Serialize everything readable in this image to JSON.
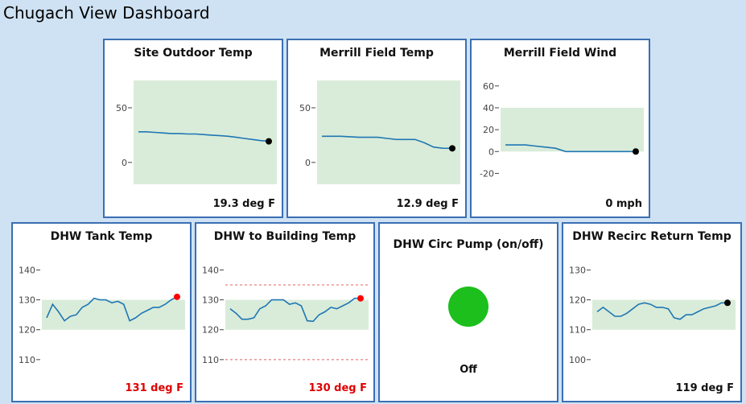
{
  "page": {
    "title": "Chugach View Dashboard"
  },
  "colors": {
    "page_bg": "#cfe2f3",
    "card_border": "#3b6fb3",
    "band": "#d9ecd9",
    "line": "#1f77b4",
    "marker_normal": "#000000",
    "marker_alert": "#ff0000",
    "pump_off": "#1cbf1c",
    "limit_line": "#e06060"
  },
  "cards": [
    {
      "title": "Site Outdoor Temp",
      "value": "19.3 deg F",
      "alert": false,
      "icon": "",
      "chart_data": {
        "type": "line",
        "ylim": [
          -20,
          75
        ],
        "yticks": [
          0,
          50
        ],
        "band": [
          -20,
          75
        ],
        "limits": [],
        "marker": "normal",
        "values": [
          28,
          28,
          27.5,
          27,
          26.5,
          26.5,
          26,
          26,
          25.5,
          25,
          24.5,
          24,
          23,
          22,
          21,
          20,
          19.3
        ]
      }
    },
    {
      "title": "Merrill Field Temp",
      "value": "12.9 deg F",
      "alert": false,
      "icon": "",
      "chart_data": {
        "type": "line",
        "ylim": [
          -20,
          75
        ],
        "yticks": [
          0,
          50
        ],
        "band": [
          -20,
          75
        ],
        "limits": [],
        "marker": "normal",
        "values": [
          24,
          24,
          24,
          23.5,
          23,
          23,
          23,
          22,
          21,
          21,
          21,
          18,
          14,
          13,
          12.9
        ]
      }
    },
    {
      "title": "Merrill Field Wind",
      "value": "0 mph",
      "alert": false,
      "icon": "",
      "chart_data": {
        "type": "line",
        "ylim": [
          -30,
          65
        ],
        "yticks": [
          -20,
          0,
          20,
          40,
          60
        ],
        "band": [
          0,
          40
        ],
        "limits": [],
        "marker": "normal",
        "values": [
          6,
          6,
          6,
          5,
          4,
          3,
          0,
          0,
          0,
          0,
          0,
          0,
          0,
          0
        ]
      }
    },
    {
      "title": "DHW Tank Temp",
      "value": "131 deg F",
      "alert": true,
      "icon": "",
      "chart_data": {
        "type": "line",
        "ylim": [
          107,
          142
        ],
        "yticks": [
          110,
          120,
          130,
          140
        ],
        "band": [
          120,
          130
        ],
        "limits": [],
        "marker": "alert",
        "values": [
          124,
          128.5,
          126,
          123,
          124.5,
          125,
          127.5,
          128.5,
          130.5,
          130,
          130,
          129,
          129.5,
          128.5,
          123,
          124,
          125.5,
          126.5,
          127.5,
          127.5,
          128.5,
          130,
          131
        ]
      }
    },
    {
      "title": "DHW to Building Temp",
      "value": "130 deg F",
      "alert": true,
      "icon": "",
      "chart_data": {
        "type": "line",
        "ylim": [
          107,
          142
        ],
        "yticks": [
          110,
          120,
          130,
          140
        ],
        "band": [
          120,
          130
        ],
        "limits": [
          135,
          110
        ],
        "marker": "alert",
        "values": [
          127,
          125.5,
          123.5,
          123.5,
          124,
          127,
          128,
          130,
          130,
          130,
          128.5,
          129,
          128,
          123,
          122.8,
          125,
          126,
          127.5,
          127,
          128,
          129,
          130.5,
          130.5
        ]
      }
    },
    {
      "title": "DHW Circ Pump (on/off)",
      "value": "Off",
      "alert": false,
      "icon": "pump-status-indicator",
      "chart_data": null
    },
    {
      "title": "DHW Recirc Return Temp",
      "value": "119 deg F",
      "alert": false,
      "icon": "",
      "chart_data": {
        "type": "line",
        "ylim": [
          97,
          132
        ],
        "yticks": [
          100,
          110,
          120,
          130
        ],
        "band": [
          110,
          120
        ],
        "limits": [],
        "marker": "normal",
        "values": [
          116,
          117.5,
          116,
          114.5,
          114.5,
          115.5,
          117,
          118.5,
          119,
          118.5,
          117.5,
          117.5,
          117,
          114,
          113.5,
          115,
          115,
          116,
          117,
          117.5,
          118,
          119,
          119
        ]
      }
    }
  ]
}
